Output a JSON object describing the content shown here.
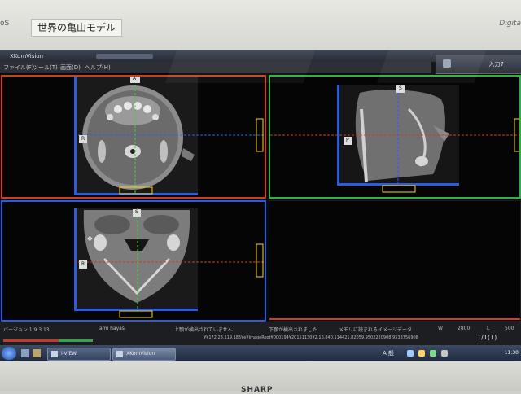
{
  "bezel": {
    "brand_left": "oS",
    "label": "世界の亀山モデル",
    "brand_right": "Digita",
    "maker": "SHARP"
  },
  "app": {
    "title": "XKomVision",
    "menu": [
      "ファイル(F)",
      "ツール(T)",
      "画面(D)",
      "ヘルプ(H)"
    ],
    "tool_label": "入力7"
  },
  "viewports": {
    "axial": {
      "orientation_top": "A",
      "orientation_left": "R"
    },
    "sagittal": {
      "orientation_top": "S",
      "orientation_left": "P"
    },
    "coronal": {
      "orientation_top": "S",
      "orientation_left": "R"
    }
  },
  "status": {
    "version": "バージョン 1.9.3.13",
    "user": "ami hayasi",
    "msg1": "上顎が検出されていません",
    "msg2": "下顎が検出されました",
    "msg3": "メモリに読まれるイメージデータ",
    "w_label": "W",
    "w_value": "2800",
    "l_label": "L",
    "l_value": "500",
    "path": "¥¥172.28.119.185¥e¥ImageRoot¥000194¥20151130¥2.16.840.114421.82059.9502220908.9533756908",
    "step_label": "1/1(1)"
  },
  "taskbar": {
    "tasks": [
      "i-VIEW",
      "XKomVision"
    ],
    "tray_text": "A 般",
    "time": "11:30"
  },
  "colors": {
    "axial_border": "#d23a24",
    "sagittal_border": "#2bb04a",
    "coronal_border": "#2b5be0"
  }
}
